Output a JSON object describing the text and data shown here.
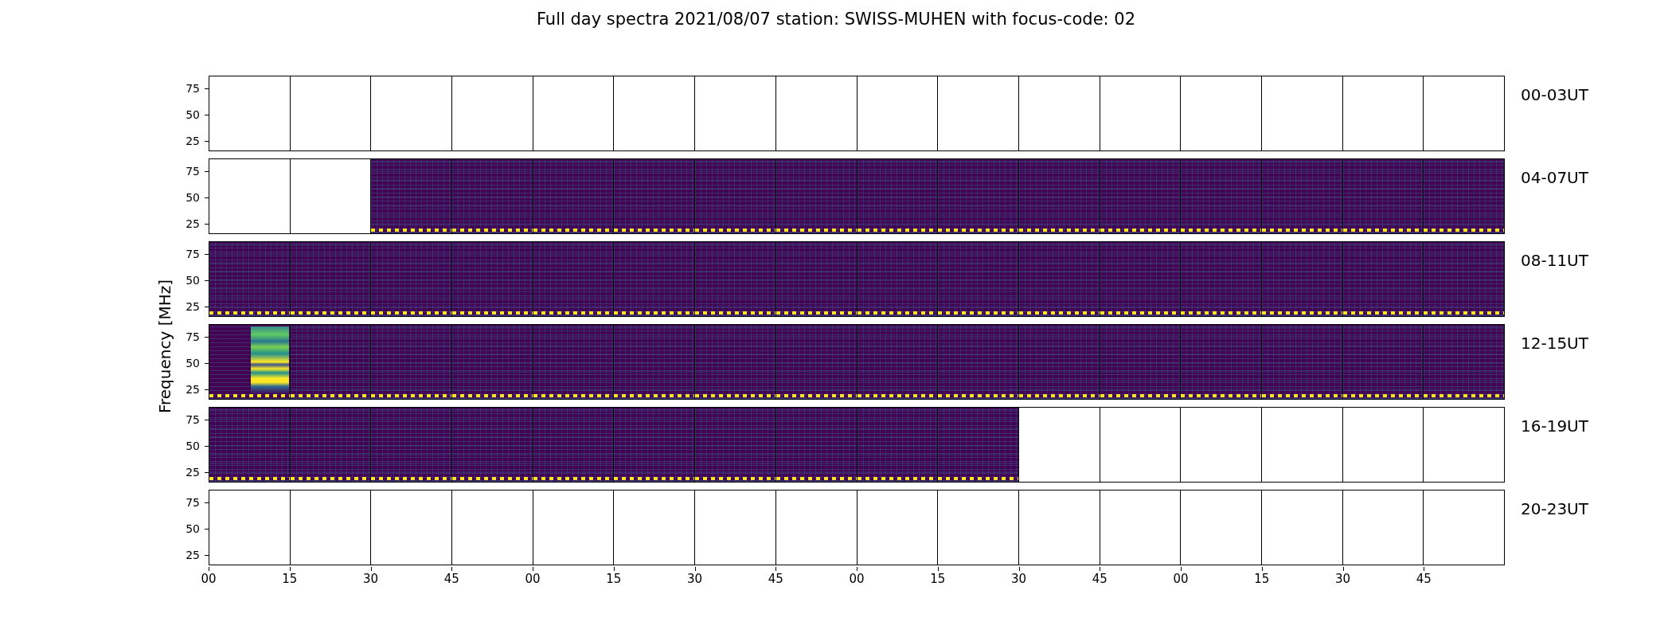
{
  "title": "Full day spectra 2021/08/07 station: SWISS-MUHEN with focus-code: 02",
  "y_axis": {
    "label": "Frequency [MHz]"
  },
  "rows": [
    {
      "label": "00-03UT",
      "yticks": [
        "75",
        "50",
        "25"
      ],
      "panels": [
        {
          "kind": "empty"
        },
        {
          "kind": "empty"
        },
        {
          "kind": "empty"
        },
        {
          "kind": "empty"
        },
        {
          "kind": "empty"
        },
        {
          "kind": "empty"
        },
        {
          "kind": "empty"
        },
        {
          "kind": "empty"
        },
        {
          "kind": "empty"
        },
        {
          "kind": "empty"
        },
        {
          "kind": "empty"
        },
        {
          "kind": "empty"
        },
        {
          "kind": "empty"
        },
        {
          "kind": "empty"
        },
        {
          "kind": "empty"
        },
        {
          "kind": "empty"
        }
      ]
    },
    {
      "label": "04-07UT",
      "yticks": [
        "75",
        "50",
        "25"
      ],
      "panels": [
        {
          "kind": "empty"
        },
        {
          "kind": "empty"
        },
        {
          "kind": "spectrum"
        },
        {
          "kind": "spectrum"
        },
        {
          "kind": "spectrum"
        },
        {
          "kind": "spectrum"
        },
        {
          "kind": "spectrum"
        },
        {
          "kind": "spectrum"
        },
        {
          "kind": "spectrum"
        },
        {
          "kind": "spectrum"
        },
        {
          "kind": "spectrum"
        },
        {
          "kind": "spectrum"
        },
        {
          "kind": "spectrum"
        },
        {
          "kind": "spectrum"
        },
        {
          "kind": "spectrum"
        },
        {
          "kind": "spectrum"
        }
      ]
    },
    {
      "label": "08-11UT",
      "yticks": [
        "75",
        "50",
        "25"
      ],
      "panels": [
        {
          "kind": "spectrum"
        },
        {
          "kind": "spectrum"
        },
        {
          "kind": "spectrum"
        },
        {
          "kind": "spectrum"
        },
        {
          "kind": "spectrum"
        },
        {
          "kind": "spectrum"
        },
        {
          "kind": "spectrum"
        },
        {
          "kind": "spectrum"
        },
        {
          "kind": "spectrum"
        },
        {
          "kind": "spectrum"
        },
        {
          "kind": "spectrum"
        },
        {
          "kind": "spectrum"
        },
        {
          "kind": "spectrum"
        },
        {
          "kind": "spectrum"
        },
        {
          "kind": "spectrum"
        },
        {
          "kind": "spectrum"
        }
      ]
    },
    {
      "label": "12-15UT",
      "yticks": [
        "75",
        "50",
        "25"
      ],
      "panels": [
        {
          "kind": "burst"
        },
        {
          "kind": "spectrum"
        },
        {
          "kind": "spectrum"
        },
        {
          "kind": "spectrum"
        },
        {
          "kind": "spectrum"
        },
        {
          "kind": "spectrum"
        },
        {
          "kind": "spectrum"
        },
        {
          "kind": "spectrum"
        },
        {
          "kind": "spectrum"
        },
        {
          "kind": "spectrum"
        },
        {
          "kind": "spectrum"
        },
        {
          "kind": "spectrum"
        },
        {
          "kind": "spectrum"
        },
        {
          "kind": "spectrum"
        },
        {
          "kind": "spectrum"
        },
        {
          "kind": "spectrum"
        }
      ]
    },
    {
      "label": "16-19UT",
      "yticks": [
        "75",
        "50",
        "25"
      ],
      "panels": [
        {
          "kind": "spectrum"
        },
        {
          "kind": "spectrum"
        },
        {
          "kind": "spectrum"
        },
        {
          "kind": "spectrum"
        },
        {
          "kind": "spectrum"
        },
        {
          "kind": "spectrum"
        },
        {
          "kind": "spectrum"
        },
        {
          "kind": "spectrum"
        },
        {
          "kind": "spectrum"
        },
        {
          "kind": "spectrum"
        },
        {
          "kind": "empty"
        },
        {
          "kind": "empty"
        },
        {
          "kind": "empty"
        },
        {
          "kind": "empty"
        },
        {
          "kind": "empty"
        },
        {
          "kind": "empty"
        }
      ]
    },
    {
      "label": "20-23UT",
      "yticks": [
        "75",
        "50",
        "25"
      ],
      "panels": [
        {
          "kind": "empty"
        },
        {
          "kind": "empty"
        },
        {
          "kind": "empty"
        },
        {
          "kind": "empty"
        },
        {
          "kind": "empty"
        },
        {
          "kind": "empty"
        },
        {
          "kind": "empty"
        },
        {
          "kind": "empty"
        },
        {
          "kind": "empty"
        },
        {
          "kind": "empty"
        },
        {
          "kind": "empty"
        },
        {
          "kind": "empty"
        },
        {
          "kind": "empty"
        },
        {
          "kind": "empty"
        },
        {
          "kind": "empty"
        },
        {
          "kind": "empty"
        }
      ]
    }
  ],
  "x_ticks": [
    "00",
    "15",
    "30",
    "45",
    "00",
    "15",
    "30",
    "45",
    "00",
    "15",
    "30",
    "45",
    "00",
    "15",
    "30",
    "45"
  ]
}
